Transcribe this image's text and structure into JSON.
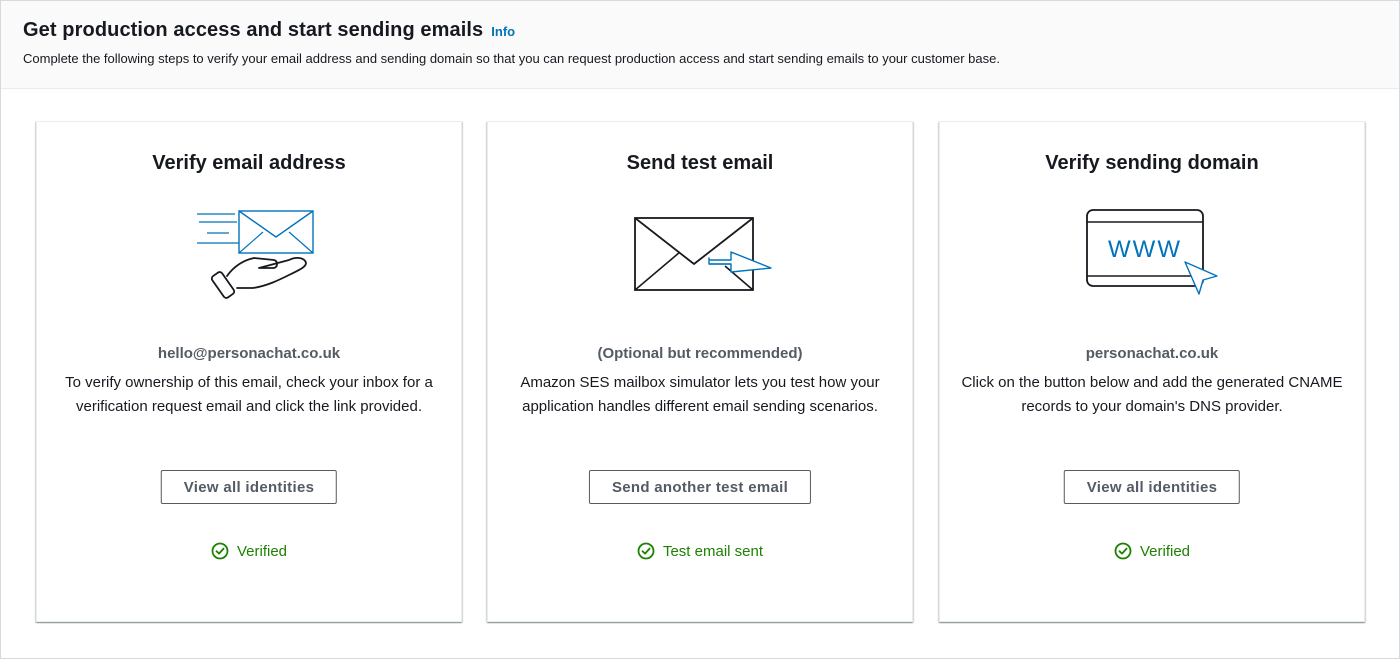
{
  "header": {
    "title": "Get production access and start sending emails",
    "info_label": "Info",
    "description": "Complete the following steps to verify your email address and sending domain so that you can request production access and start sending emails to your customer base."
  },
  "cards": [
    {
      "title": "Verify email address",
      "illustration": "email-in-hand-icon",
      "subtitle": "hello@personachat.co.uk",
      "description": "To verify ownership of this email, check your inbox for a verification request email and click the link provided.",
      "button_label": "View all identities",
      "status_icon": "check-circle-icon",
      "status_text": "Verified"
    },
    {
      "title": "Send test email",
      "illustration": "envelope-send-icon",
      "subtitle": "(Optional but recommended)",
      "description": "Amazon SES mailbox simulator lets you test how your application handles different email sending scenarios.",
      "button_label": "Send another test email",
      "status_icon": "check-circle-icon",
      "status_text": "Test email sent"
    },
    {
      "title": "Verify sending domain",
      "illustration": "www-browser-icon",
      "subtitle": "personachat.co.uk",
      "description": "Click on the button below and add the generated CNAME records to your domain's DNS provider.",
      "button_label": "View all identities",
      "status_icon": "check-circle-icon",
      "status_text": "Verified"
    }
  ],
  "illustration_texts": {
    "www": "WWW"
  },
  "colors": {
    "accent_blue": "#0073bb",
    "success_green": "#1d8102",
    "text_dark": "#16191f",
    "text_muted": "#545b64"
  }
}
